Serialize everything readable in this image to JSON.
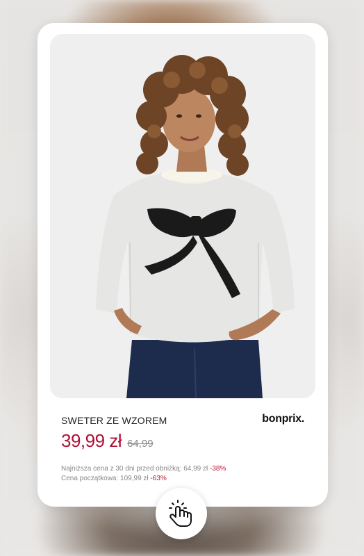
{
  "product": {
    "title": "SWETER ZE WZOREM",
    "brand": "bonprix.",
    "price": "39,99 zł",
    "old_price": "64,99",
    "lowest_price_label": "Najniższa cena z 30 dni  przed obniżką: 64,99 zł",
    "lowest_price_discount": "-38%",
    "initial_price_label": "Cena początkowa: 109,99 zł",
    "initial_price_discount": "-63%"
  },
  "icons": {
    "tap": "hand-tap-icon"
  },
  "colors": {
    "price": "#b00f36",
    "discount": "#c3102f",
    "card": "#ffffff"
  }
}
